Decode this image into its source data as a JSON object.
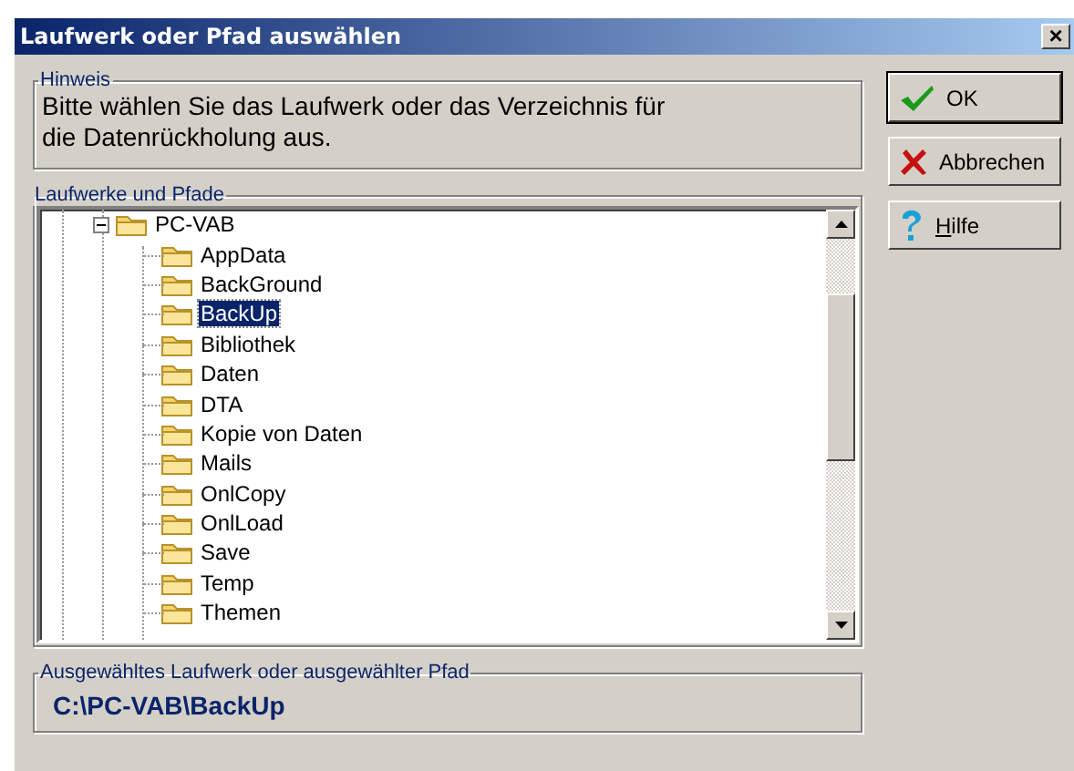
{
  "window": {
    "title": "Laufwerk oder Pfad auswählen",
    "close": "×"
  },
  "hint": {
    "legend": "Hinweis",
    "text": "Bitte wählen Sie das Laufwerk oder das Verzeichnis für die Datenrückholung aus."
  },
  "tree": {
    "legend": "Laufwerke und Pfade",
    "items": [
      {
        "label": "PC-VAB",
        "expanded": true,
        "selected": false,
        "children": [
          {
            "label": "AppData",
            "selected": false
          },
          {
            "label": "BackGround",
            "selected": false
          },
          {
            "label": "BackUp",
            "selected": true
          },
          {
            "label": "Bibliothek",
            "selected": false
          },
          {
            "label": "Daten",
            "selected": false
          },
          {
            "label": "DTA",
            "selected": false
          },
          {
            "label": "Kopie von Daten",
            "selected": false
          },
          {
            "label": "Mails",
            "selected": false
          },
          {
            "label": "OnlCopy",
            "selected": false
          },
          {
            "label": "OnlLoad",
            "selected": false
          },
          {
            "label": "Save",
            "selected": false
          },
          {
            "label": "Temp",
            "selected": false
          },
          {
            "label": "Themen",
            "selected": false
          }
        ]
      }
    ]
  },
  "selection": {
    "legend": "Ausgewähltes Laufwerk oder ausgewählter Pfad",
    "path": "C:\\PC-VAB\\BackUp"
  },
  "buttons": [
    {
      "kind": "ok",
      "label": "OK",
      "default": true,
      "first_letter_underlined": false
    },
    {
      "kind": "cancel",
      "label": "Abbrechen",
      "default": false,
      "first_letter_underlined": false
    },
    {
      "kind": "help",
      "label": "Hilfe",
      "default": false,
      "first_letter_underlined": true
    }
  ]
}
